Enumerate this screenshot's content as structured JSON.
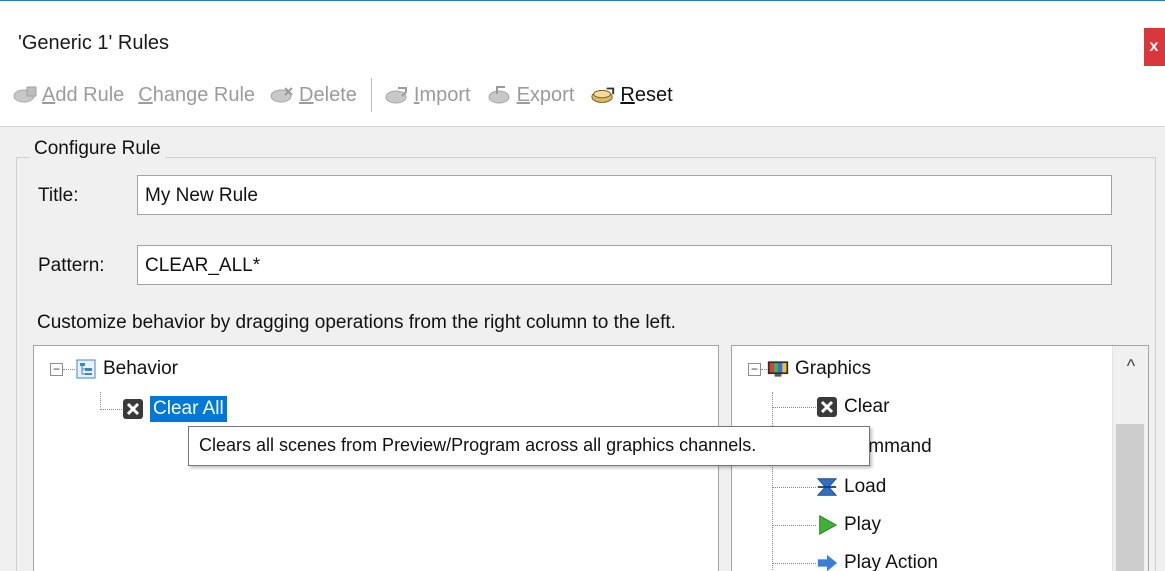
{
  "window": {
    "title": "'Generic 1' Rules",
    "close_label": "x"
  },
  "toolbar": {
    "add_rule": {
      "label": "Add Rule",
      "mnemonic": "A",
      "rest": "dd Rule",
      "icon": "add-rule-icon",
      "enabled": false
    },
    "change_rule": {
      "label": "Change Rule",
      "mnemonic": "C",
      "rest": "hange Rule",
      "enabled": false
    },
    "delete": {
      "label": "Delete",
      "mnemonic": "D",
      "rest": "elete",
      "icon": "delete-icon",
      "enabled": false
    },
    "import": {
      "label": "Import",
      "mnemonic": "I",
      "rest": "mport",
      "icon": "import-icon",
      "enabled": false
    },
    "export": {
      "label": "Export",
      "mnemonic": "E",
      "rest": "xport",
      "icon": "export-icon",
      "enabled": false
    },
    "reset": {
      "label": "Reset",
      "mnemonic": "R",
      "rest": "eset",
      "icon": "reset-icon",
      "enabled": true
    }
  },
  "configure": {
    "legend": "Configure Rule",
    "title_label": "Title:",
    "title_value": "My New Rule",
    "pattern_label": "Pattern:",
    "pattern_value": "CLEAR_ALL*",
    "hint": "Customize behavior by dragging operations from the right column to the left."
  },
  "behavior_tree": {
    "root": {
      "label": "Behavior",
      "expander": "−",
      "icon": "behavior-icon"
    },
    "children": [
      {
        "label": "Clear All",
        "icon": "clear-icon",
        "selected": true
      }
    ]
  },
  "operations_tree": {
    "root": {
      "label": "Graphics",
      "expander": "−",
      "icon": "graphics-icon"
    },
    "children": [
      {
        "label": "Clear",
        "icon": "clear-icon"
      },
      {
        "label": "Command",
        "icon": "command-icon"
      },
      {
        "label": "Load",
        "icon": "load-icon"
      },
      {
        "label": "Play",
        "icon": "play-icon"
      },
      {
        "label": "Play Action",
        "icon": "play-action-icon"
      }
    ]
  },
  "tooltip": {
    "text": "Clears all scenes from Preview/Program across all graphics channels."
  },
  "scrollbar": {
    "up_arrow": "^"
  },
  "colors": {
    "selection": "#0078d7",
    "close_button": "#d9373b",
    "title_accent": "#2b79c9",
    "panel_bg": "#f0f0f0"
  }
}
